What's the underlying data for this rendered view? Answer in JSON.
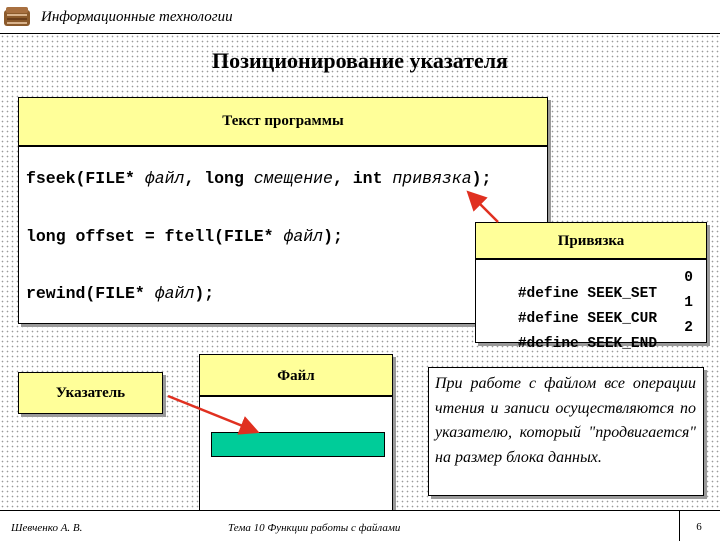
{
  "header": {
    "title": "Информационные технологии",
    "logo_icon": "book-stack-icon"
  },
  "slide": {
    "title": "Позиционирование указателя"
  },
  "program_box": {
    "heading": "Текст программы",
    "lines": [
      {
        "parts": [
          {
            "t": "fseek(FILE* ",
            "i": false
          },
          {
            "t": "файл",
            "i": true
          },
          {
            "t": ", long ",
            "i": false
          },
          {
            "t": "смещение",
            "i": true
          },
          {
            "t": ", int ",
            "i": false
          },
          {
            "t": "привязка",
            "i": true
          },
          {
            "t": ");",
            "i": false
          }
        ]
      },
      {
        "parts": [
          {
            "t": "long offset = ftell(FILE* ",
            "i": false
          },
          {
            "t": "файл",
            "i": true
          },
          {
            "t": ");",
            "i": false
          }
        ]
      },
      {
        "parts": [
          {
            "t": "rewind(FILE* ",
            "i": false
          },
          {
            "t": "файл",
            "i": true
          },
          {
            "t": ");",
            "i": false
          }
        ]
      }
    ]
  },
  "binding_box": {
    "heading": "Привязка",
    "defines": [
      {
        "name": "#define SEEK_SET",
        "value": "0"
      },
      {
        "name": "#define SEEK_CUR",
        "value": "1"
      },
      {
        "name": "#define SEEK_END",
        "value": "2"
      }
    ]
  },
  "pointer_box": {
    "label": "Указатель"
  },
  "file_box": {
    "heading": "Файл",
    "block_color": "#00cc99"
  },
  "note": {
    "text": "При работе с файлом все операции чтения и записи осуществляются по указателю, который \"продвигается\" на размер блока данных."
  },
  "footer": {
    "author": "Шевченко А. В.",
    "topic": "Тема 10 Функции работы с файлами",
    "page_number": "6"
  },
  "colors": {
    "box_header": "#ffff99",
    "arrow": "#e03020"
  }
}
